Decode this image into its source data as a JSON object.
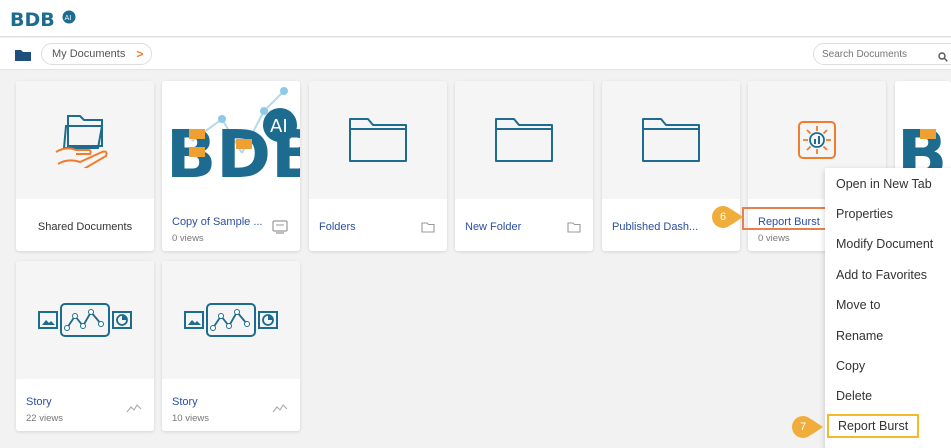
{
  "app": {
    "logo_text": "BDB",
    "logo_badge": "AI"
  },
  "breadcrumb": {
    "label": "My Documents",
    "chevron": ">"
  },
  "search": {
    "placeholder": "Search Documents"
  },
  "cards": [
    {
      "name": "Shared Documents",
      "views": "",
      "icon": "shared-folder-icon"
    },
    {
      "name": "Copy of Sample ...",
      "views": "0 views",
      "icon": "bdb-ai-logo"
    },
    {
      "name": "Folders",
      "views": "",
      "icon": "folder-icon"
    },
    {
      "name": "New Folder",
      "views": "",
      "icon": "folder-icon"
    },
    {
      "name": "Published Dash...",
      "views": "",
      "icon": "folder-icon"
    },
    {
      "name": "Report Burst",
      "views": "0 views",
      "icon": "report-burst-icon"
    },
    {
      "name": "Story",
      "views": "22 views",
      "icon": "story-icon"
    },
    {
      "name": "Story",
      "views": "10 views",
      "icon": "story-icon"
    }
  ],
  "context_menu": {
    "items": [
      "Open in New Tab",
      "Properties",
      "Modify Document",
      "Add to Favorites",
      "Move to",
      "Rename",
      "Copy",
      "Delete",
      "Report Burst"
    ]
  },
  "annotations": {
    "step6": "6",
    "step7": "7"
  },
  "colors": {
    "accent": "#f07c2c",
    "brand_blue": "#1d6b8f",
    "link_blue": "#2b4ea2",
    "callout": "#f0ad3c"
  }
}
